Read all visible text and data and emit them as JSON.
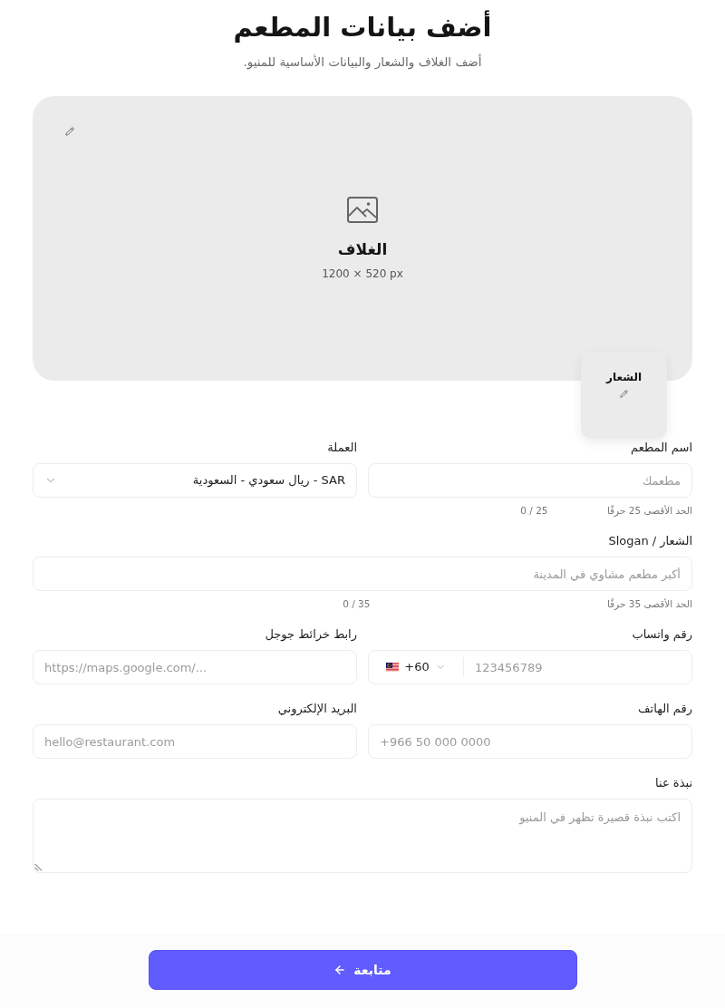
{
  "header": {
    "title": "أضف بيانات المطعم",
    "subtitle": "أضف الغلاف والشعار والبيانات الأساسية للمنيو."
  },
  "cover": {
    "title": "الغلاف",
    "size_hint": "1200 × 520 px"
  },
  "logo": {
    "title": "الشعار"
  },
  "form_rows": [
    [
      {
        "kind": "text",
        "label": "اسم المطعم",
        "placeholder": "مطعمك",
        "hint": "الحد الأقصى 25 حرفًا",
        "counter": "0 / 25"
      },
      {
        "kind": "select",
        "label": "العملة",
        "value": "SAR - ريال سعودي - السعودية"
      }
    ],
    [
      {
        "kind": "text",
        "label": "الشعار / Slogan",
        "placeholder": "أكبر مطعم مشاوي في المدينة",
        "hint": "الحد الأقصى 35 حرفًا",
        "counter": "0 / 35"
      }
    ],
    [
      {
        "kind": "phone",
        "label": "رقم واتساب",
        "country_code": "+60",
        "placeholder": "123456789"
      },
      {
        "kind": "url",
        "label": "رابط خرائط جوجل",
        "placeholder": "https://maps.google.com/..."
      }
    ],
    [
      {
        "kind": "tel",
        "label": "رقم الهاتف",
        "placeholder": "+966 50 000 0000"
      },
      {
        "kind": "email",
        "label": "البريد الإلكتروني",
        "placeholder": "hello@restaurant.com"
      }
    ],
    [
      {
        "kind": "textarea",
        "label": "نبذة عنا",
        "placeholder": "اكتب نبذة قصيرة تظهر في المنيو"
      }
    ]
  ],
  "continue_button": {
    "label": "متابعة"
  }
}
